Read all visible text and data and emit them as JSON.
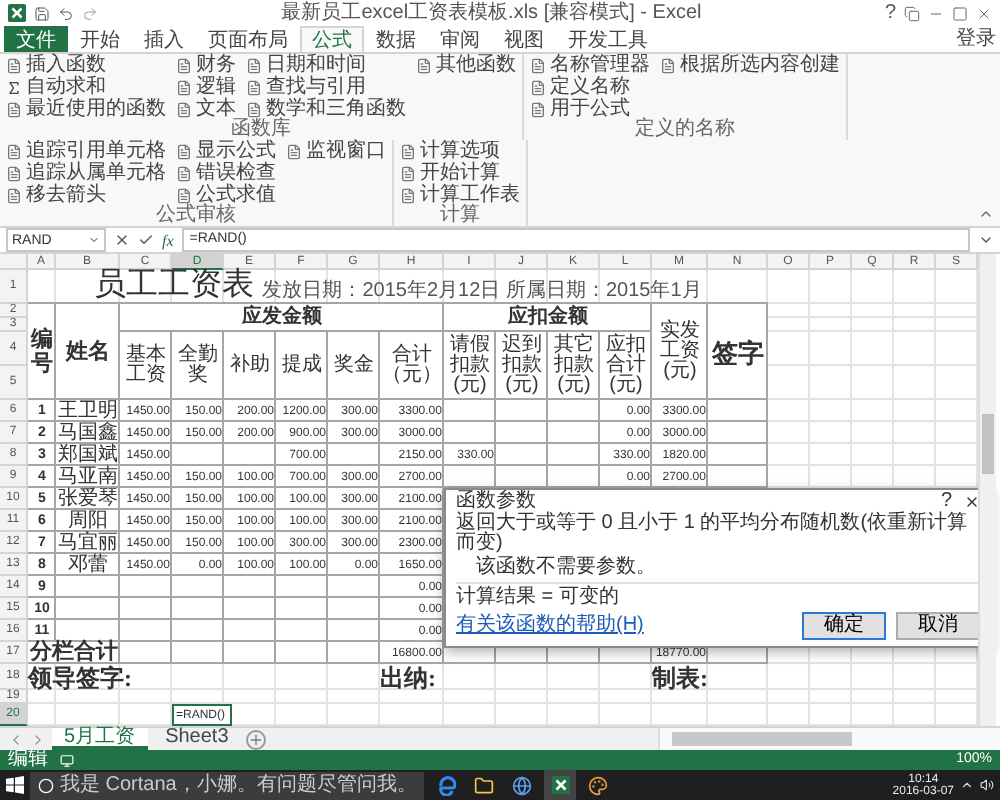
{
  "title_bar": {
    "title": "最新员工excel工资表模板.xls [兼容模式] - Excel",
    "help": "?"
  },
  "ribbon_tabs": [
    {
      "label": "文件",
      "kind": "file",
      "selected": false
    },
    {
      "label": "开始",
      "kind": "tab",
      "selected": false
    },
    {
      "label": "插入",
      "kind": "tab",
      "selected": false
    },
    {
      "label": "页面布局",
      "kind": "tab",
      "selected": false
    },
    {
      "label": "公式",
      "kind": "tab",
      "selected": true
    },
    {
      "label": "数据",
      "kind": "tab",
      "selected": false
    },
    {
      "label": "审阅",
      "kind": "tab",
      "selected": false
    },
    {
      "label": "视图",
      "kind": "tab",
      "selected": false
    },
    {
      "label": "开发工具",
      "kind": "tab",
      "selected": false
    }
  ],
  "sign_in": "登录",
  "ribbon_groups": [
    {
      "label": "函数库",
      "columns": [
        [
          "插入函数",
          "自动求和",
          "最近使用的函数"
        ],
        [
          "财务",
          "逻辑",
          "文本"
        ],
        [
          "日期和时间",
          "查找与引用",
          "数学和三角函数"
        ],
        [
          "其他函数"
        ]
      ]
    },
    {
      "label": "定义的名称",
      "columns": [
        [
          "名称管理器",
          "定义名称",
          "用于公式"
        ],
        [
          "根据所选内容创建"
        ]
      ]
    },
    {
      "label": "公式审核",
      "columns": [
        [
          "追踪引用单元格",
          "追踪从属单元格",
          "移去箭头"
        ],
        [
          "显示公式",
          "错误检查",
          "公式求值"
        ],
        [
          "监视窗口"
        ]
      ]
    },
    {
      "label": "计算",
      "columns": [
        [
          "计算选项",
          "开始计算",
          "计算工作表"
        ]
      ]
    }
  ],
  "formula_bar": {
    "name_box": "RAND",
    "function_button": "fx",
    "formula": "=RAND()"
  },
  "columns": [
    {
      "label": "A",
      "selected": false
    },
    {
      "label": "B",
      "selected": false
    },
    {
      "label": "C",
      "selected": false
    },
    {
      "label": "D",
      "selected": true
    },
    {
      "label": "E",
      "selected": false
    },
    {
      "label": "F",
      "selected": false
    },
    {
      "label": "G",
      "selected": false
    },
    {
      "label": "H",
      "selected": false
    },
    {
      "label": "I",
      "selected": false
    },
    {
      "label": "J",
      "selected": false
    },
    {
      "label": "K",
      "selected": false
    },
    {
      "label": "L",
      "selected": false
    },
    {
      "label": "M",
      "selected": false
    },
    {
      "label": "N",
      "selected": false
    },
    {
      "label": "O",
      "selected": false
    },
    {
      "label": "P",
      "selected": false
    },
    {
      "label": "Q",
      "selected": false
    },
    {
      "label": "R",
      "selected": false
    },
    {
      "label": "S",
      "selected": false
    }
  ],
  "row_numbers": [
    {
      "label": "1",
      "selected": false
    },
    {
      "label": "2",
      "selected": false
    },
    {
      "label": "3",
      "selected": false
    },
    {
      "label": "4",
      "selected": false
    },
    {
      "label": "5",
      "selected": false
    },
    {
      "label": "6",
      "selected": false
    },
    {
      "label": "7",
      "selected": false
    },
    {
      "label": "8",
      "selected": false
    },
    {
      "label": "9",
      "selected": false
    },
    {
      "label": "10",
      "selected": false
    },
    {
      "label": "11",
      "selected": false
    },
    {
      "label": "12",
      "selected": false
    },
    {
      "label": "13",
      "selected": false
    },
    {
      "label": "14",
      "selected": false
    },
    {
      "label": "15",
      "selected": false
    },
    {
      "label": "16",
      "selected": false
    },
    {
      "label": "17",
      "selected": false
    },
    {
      "label": "18",
      "selected": false
    },
    {
      "label": "19",
      "selected": false
    },
    {
      "label": "20",
      "selected": true
    }
  ],
  "sheet": {
    "title": "员工工资表",
    "subtitle": "发放日期：2015年2月12日 所属日期：2015年1月",
    "header": {
      "number": "编号",
      "name": "姓名",
      "groups": [
        {
          "label": "应发金额",
          "columns": [
            "基本工资",
            "全勤奖",
            "补助",
            "提成",
            "奖金",
            "合计（元）"
          ]
        },
        {
          "label": "应扣金额",
          "columns": [
            "请假扣款(元)",
            "迟到扣款(元)",
            "其它扣款(元)",
            "应扣合计(元)"
          ]
        }
      ],
      "net": "实发工资(元)",
      "signature": "签字"
    },
    "rows": [
      {
        "no": "1",
        "name": "王卫明",
        "values": {
          "C": "1450.00",
          "D": "150.00",
          "E": "200.00",
          "F": "1200.00",
          "G": "300.00",
          "H": "3300.00",
          "L": "0.00",
          "M": "3300.00"
        }
      },
      {
        "no": "2",
        "name": "马国鑫",
        "values": {
          "C": "1450.00",
          "D": "150.00",
          "E": "200.00",
          "F": "900.00",
          "G": "300.00",
          "H": "3000.00",
          "L": "0.00",
          "M": "3000.00"
        }
      },
      {
        "no": "3",
        "name": "郑国斌",
        "values": {
          "C": "1450.00",
          "F": "700.00",
          "H": "2150.00",
          "I": "330.00",
          "L": "330.00",
          "M": "1820.00"
        }
      },
      {
        "no": "4",
        "name": "马亚南",
        "values": {
          "C": "1450.00",
          "D": "150.00",
          "E": "100.00",
          "F": "700.00",
          "G": "300.00",
          "H": "2700.00",
          "L": "0.00",
          "M": "2700.00"
        }
      },
      {
        "no": "5",
        "name": "张爱琴",
        "values": {
          "C": "1450.00",
          "D": "150.00",
          "E": "100.00",
          "F": "100.00",
          "G": "300.00",
          "H": "2100.00"
        }
      },
      {
        "no": "6",
        "name": "周阳",
        "values": {
          "C": "1450.00",
          "D": "150.00",
          "E": "100.00",
          "F": "100.00",
          "G": "300.00",
          "H": "2100.00"
        }
      },
      {
        "no": "7",
        "name": "马宜丽",
        "values": {
          "C": "1450.00",
          "D": "150.00",
          "E": "100.00",
          "F": "300.00",
          "G": "300.00",
          "H": "2300.00"
        }
      },
      {
        "no": "8",
        "name": "邓蕾",
        "values": {
          "C": "1450.00",
          "D": "0.00",
          "E": "100.00",
          "F": "100.00",
          "G": "0.00",
          "H": "1650.00"
        }
      },
      {
        "no": "9",
        "values": {
          "H": "0.00"
        }
      },
      {
        "no": "10",
        "values": {
          "H": "0.00"
        }
      },
      {
        "no": "11",
        "values": {
          "H": "0.00"
        }
      }
    ],
    "total": {
      "label": "分栏合计",
      "values": {
        "H": "16800.00",
        "M": "18770.00"
      }
    },
    "signatures": [
      "领导签字:",
      "出纳:",
      "制表:"
    ],
    "active_cell": "=RAND()"
  },
  "dialog": {
    "title": "函数参数",
    "help": "?",
    "description": "返回大于或等于 0 且小于 1 的平均分布随机数(依重新计算而变)",
    "note": "该函数不需要参数。",
    "result": "计算结果 =  可变的",
    "help_link": "有关该函数的帮助(H)",
    "buttons": [
      "确定",
      "取消"
    ]
  },
  "sheet_tabs": [
    {
      "label": "5月工资",
      "selected": true
    },
    {
      "label": "Sheet3",
      "selected": false
    }
  ],
  "status_bar": {
    "mode": "编辑",
    "zoom": "100%"
  },
  "taskbar": {
    "search": "我是 Cortana，小娜。有问题尽管问我。",
    "time": "10:14",
    "date": "2016-03-07"
  }
}
